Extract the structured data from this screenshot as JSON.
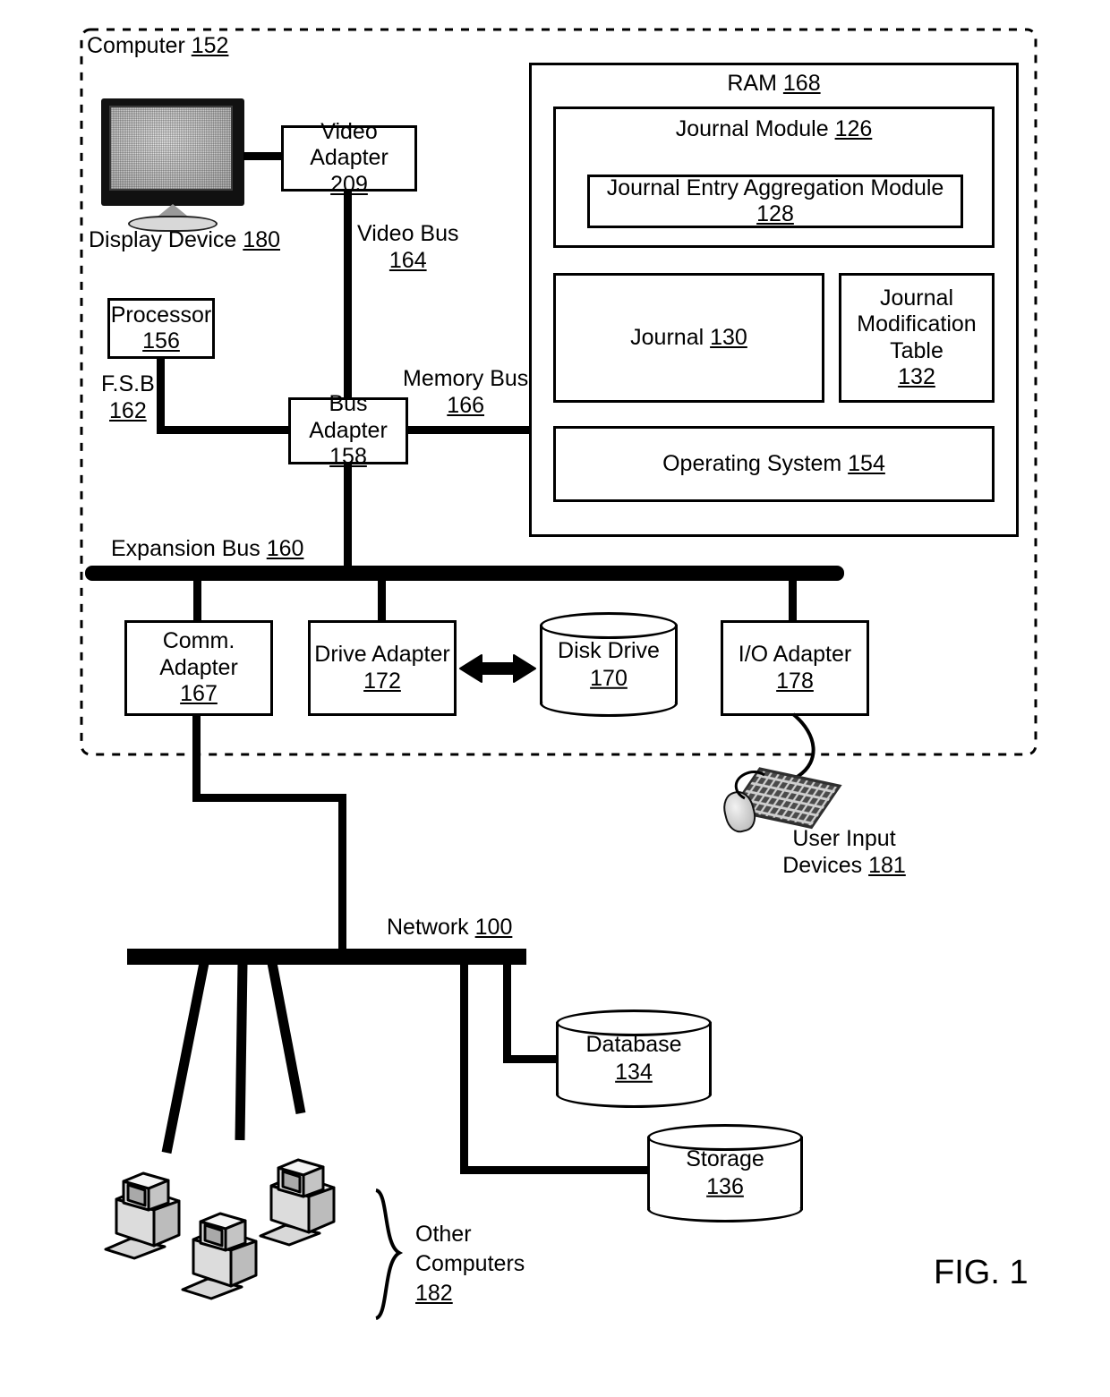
{
  "figure": {
    "label": "FIG. 1"
  },
  "enclosure": {
    "title": "Computer",
    "ref": "152"
  },
  "display": {
    "label": "Display Device",
    "ref": "180"
  },
  "video_adapter": {
    "label": "Video Adapter",
    "ref": "209"
  },
  "video_bus": {
    "label": "Video Bus",
    "ref": "164"
  },
  "processor": {
    "label": "Processor",
    "ref": "156"
  },
  "fsb": {
    "label": "F.S.B",
    "ref": "162"
  },
  "bus_adapter": {
    "label": "Bus Adapter",
    "ref": "158"
  },
  "memory_bus": {
    "label": "Memory Bus",
    "ref": "166"
  },
  "expansion_bus": {
    "label": "Expansion Bus",
    "ref": "160"
  },
  "ram": {
    "label": "RAM",
    "ref": "168",
    "journal_module": {
      "label": "Journal Module",
      "ref": "126"
    },
    "journal_entry_aggregation_module": {
      "label": "Journal Entry Aggregation Module",
      "ref": "128"
    },
    "journal": {
      "label": "Journal",
      "ref": "130"
    },
    "journal_modification_table": {
      "line1": "Journal",
      "line2": "Modification",
      "line3": "Table",
      "ref": "132"
    },
    "operating_system": {
      "label": "Operating System",
      "ref": "154"
    }
  },
  "comm_adapter": {
    "label": "Comm. Adapter",
    "ref": "167"
  },
  "drive_adapter": {
    "label": "Drive Adapter",
    "ref": "172"
  },
  "disk_drive": {
    "label": "Disk Drive",
    "ref": "170"
  },
  "io_adapter": {
    "label": "I/O Adapter",
    "ref": "178"
  },
  "user_input_devices": {
    "line1": "User Input",
    "line2": "Devices",
    "ref": "181"
  },
  "network": {
    "label": "Network",
    "ref": "100"
  },
  "database": {
    "label": "Database",
    "ref": "134"
  },
  "storage": {
    "label": "Storage",
    "ref": "136"
  },
  "other_computers": {
    "line1": "Other",
    "line2": "Computers",
    "ref": "182"
  },
  "colors": {
    "stroke": "#000000",
    "background": "#ffffff",
    "screen_fill": "#c9c9c9"
  }
}
